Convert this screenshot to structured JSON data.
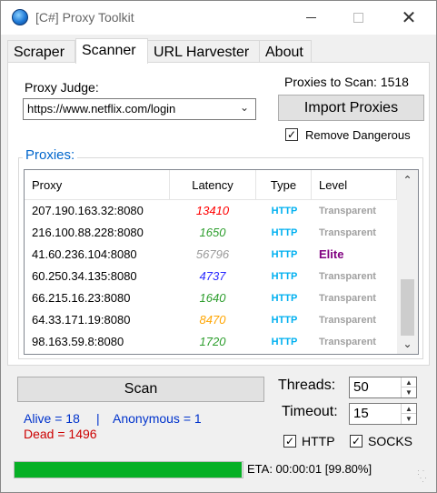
{
  "window": {
    "title": "[C#] Proxy Toolkit"
  },
  "tabs": [
    "Scraper",
    "Scanner",
    "URL Harvester",
    "About"
  ],
  "active_tab": "Scanner",
  "judge": {
    "label": "Proxy Judge:",
    "value": "https://www.netflix.com/login"
  },
  "to_scan": "Proxies to Scan: 1518",
  "import_label": "Import Proxies",
  "remove_dangerous": {
    "label": "Remove Dangerous",
    "checked": true
  },
  "group_title": "Proxies:",
  "columns": [
    "Proxy",
    "Latency",
    "Type",
    "Level"
  ],
  "rows": [
    {
      "proxy": "207.190.163.32:8080",
      "latency": "13410",
      "latency_color": "#ff0000",
      "type": "HTTP",
      "level": "Transparent",
      "level_color": "#a0a0a0"
    },
    {
      "proxy": "216.100.88.228:8080",
      "latency": "1650",
      "latency_color": "#2e9e2e",
      "type": "HTTP",
      "level": "Transparent",
      "level_color": "#a0a0a0"
    },
    {
      "proxy": "41.60.236.104:8080",
      "latency": "56796",
      "latency_color": "#9a9a9a",
      "type": "HTTP",
      "level": "Elite",
      "level_color": "#800080"
    },
    {
      "proxy": "60.250.34.135:8080",
      "latency": "4737",
      "latency_color": "#2b2bff",
      "type": "HTTP",
      "level": "Transparent",
      "level_color": "#a0a0a0"
    },
    {
      "proxy": "66.215.16.23:8080",
      "latency": "1640",
      "latency_color": "#2e9e2e",
      "type": "HTTP",
      "level": "Transparent",
      "level_color": "#a0a0a0"
    },
    {
      "proxy": "64.33.171.19:8080",
      "latency": "8470",
      "latency_color": "#ffa500",
      "type": "HTTP",
      "level": "Transparent",
      "level_color": "#a0a0a0"
    },
    {
      "proxy": "98.163.59.8:8080",
      "latency": "1720",
      "latency_color": "#2e9e2e",
      "type": "HTTP",
      "level": "Transparent",
      "level_color": "#a0a0a0"
    }
  ],
  "scan_label": "Scan",
  "stats": {
    "alive": "Alive = 18",
    "sep": "|",
    "anonymous": "Anonymous = 1",
    "dead": "Dead = 1496"
  },
  "threads": {
    "label": "Threads:",
    "value": "50"
  },
  "timeout": {
    "label": "Timeout:",
    "value": "15"
  },
  "http_check": {
    "label": "HTTP",
    "checked": true
  },
  "socks_check": {
    "label": "SOCKS",
    "checked": true
  },
  "progress": {
    "fraction": 0.998
  },
  "eta": "ETA: 00:00:01  [99.80%]",
  "colors": {
    "link_blue": "#0033cc",
    "dead_red": "#cc0000",
    "type_cyan": "#00b0f0"
  },
  "icons": {
    "app": "globe-icon",
    "dropdown": "chevron-down-icon"
  }
}
